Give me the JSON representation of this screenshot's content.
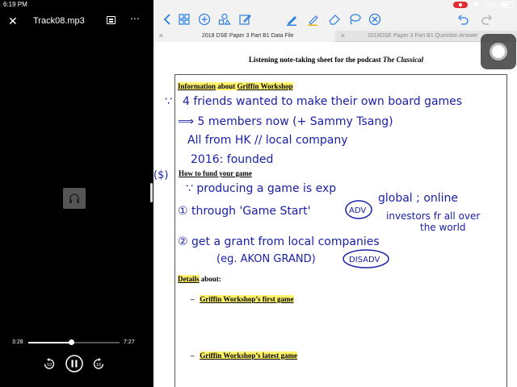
{
  "status": {
    "time": "6:19 PM",
    "battery": "55%",
    "battery_level": 0.55
  },
  "player": {
    "title": "Track08.mp3",
    "current_time": "3:28",
    "duration": "7:27",
    "progress": 0.465,
    "icons": {
      "close": "close-icon",
      "subtitles": "subtitles-icon",
      "more": "more-vert-icon",
      "art": "headphones-icon",
      "rewind": "replay-10-icon",
      "pause": "pause-icon",
      "forward": "forward-10-icon"
    }
  },
  "toolbar": {
    "icons": [
      "back-icon",
      "grid-icon",
      "add-icon",
      "shapes-icon",
      "edit-icon",
      "pen-icon",
      "highlighter-icon",
      "eraser-icon",
      "lasso-icon",
      "close-circle-icon",
      "undo-icon",
      "redo-icon"
    ],
    "accent": "#2a7de1"
  },
  "tabs": [
    {
      "label": "2018 DSE Paper 3 Part B1 Data File"
    },
    {
      "label": "2018DSE Paper 3 Part B1 Question Answer"
    }
  ],
  "doc": {
    "title_main": "Listening note-taking sheet for the podcast ",
    "title_italic": "The Classical",
    "info_heading_a": "Information",
    "info_heading_b": " about ",
    "info_heading_c": "Griffin Workshop",
    "fund_heading": "How to fund your game",
    "details_heading_a": "Details",
    "details_heading_b": " about:",
    "first_game_a": "Griffin Workshop’s ",
    "first_game_b": "first game",
    "latest_game_a": "Griffin Workshop’s ",
    "latest_game_b": "latest game",
    "dash": "–"
  },
  "handwriting": {
    "l1_mark": "∵",
    "l1": "4 friends wanted to make their own board games",
    "l2": "⟹  5 members now (+ Sammy Tsang)",
    "l3": "All from HK // local company",
    "l4": "2016: founded",
    "dollar": "($)",
    "l5": "∵ producing a game is exp",
    "l6": "① through 'Game Start'",
    "adv": "ADV",
    "l6b": "global ; online",
    "l6c": "investors fr all over",
    "l6d": "the world",
    "l7": "② get a grant from local companies",
    "l8": "(eg. AKON GRAND)",
    "disadv": "DISADV"
  }
}
